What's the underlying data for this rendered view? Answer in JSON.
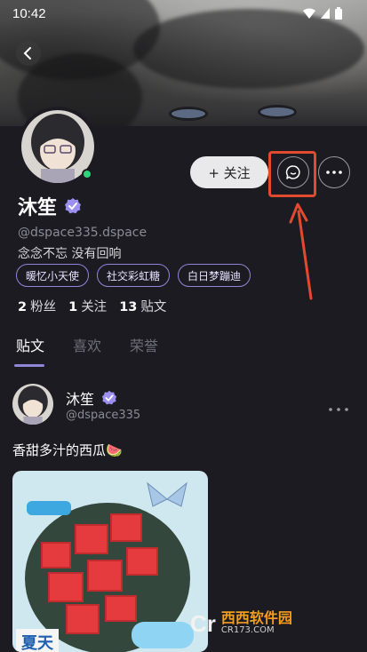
{
  "status_bar": {
    "time": "10:42"
  },
  "profile": {
    "name": "沐笙",
    "handle": "@dspace335.dspace",
    "bio": "念念不忘 没有回响",
    "tags": [
      "暖忆小天使",
      "社交彩虹糖",
      "白日梦蹦迪"
    ],
    "follow_label": "+ 关注",
    "stats": [
      {
        "count": "2",
        "label": "粉丝"
      },
      {
        "count": "1",
        "label": "关注"
      },
      {
        "count": "13",
        "label": "贴文"
      }
    ]
  },
  "tabs": [
    "贴文",
    "喜欢",
    "荣誉"
  ],
  "post": {
    "author": "沐笙",
    "handle": "@dspace335",
    "text": "香甜多汁的西瓜🍉",
    "image_caption": "夏天"
  },
  "watermark": {
    "logo": "Cr",
    "main": "西西软件园",
    "sub": "CR173.COM"
  },
  "colors": {
    "accent": "#8f86d6",
    "highlight": "#e24a2f",
    "online": "#2fd47a"
  }
}
